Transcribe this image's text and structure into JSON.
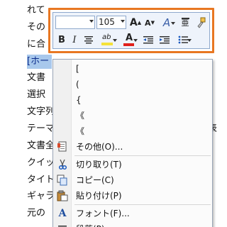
{
  "document": {
    "lines": [
      {
        "text": "れて"
      },
      {
        "text": "その"
      },
      {
        "text": "に合"
      },
      {
        "text": "[ホー",
        "selected": true
      },
      {
        "text": "文書"
      },
      {
        "text": "選択"
      },
      {
        "text": "文字列"
      },
      {
        "text": "テーマ"
      },
      {
        "text": "文書全"
      },
      {
        "text": "クイッ"
      },
      {
        "text": "タイト"
      },
      {
        "text": "ギャラ"
      },
      {
        "text": "元の"
      }
    ],
    "right_fragments": [
      {
        "text": "]"
      },
      {
        "text": "]"
      },
      {
        "text": "る表"
      }
    ]
  },
  "mini_toolbar": {
    "font_name": "",
    "font_size": "105",
    "grow_font": "A",
    "shrink_font": "A",
    "styles_label": "A",
    "phonetic_label": "亜",
    "bold": "B",
    "italic": "I",
    "highlight_label": "ab",
    "font_color_label": "A",
    "colors": {
      "highlight": "#f5e23a",
      "font_color": "#e0201b",
      "frame": "#e87722"
    }
  },
  "context_menu": {
    "items": [
      {
        "label": "[",
        "icon": ""
      },
      {
        "label": "(",
        "icon": ""
      },
      {
        "label": "{",
        "icon": ""
      },
      {
        "label": "《",
        "icon": ""
      },
      {
        "label": "《",
        "icon": ""
      },
      {
        "label": "その他(O)...",
        "icon": "document-icon"
      },
      {
        "label": "切り取り(T)",
        "icon": "scissors-icon"
      },
      {
        "label": "コピー(C)",
        "icon": "copy-icon"
      },
      {
        "label": "貼り付け(P)",
        "icon": "paste-icon"
      },
      {
        "label": "フォント(F)...",
        "icon": "font-icon"
      },
      {
        "label": "段落(P)...",
        "icon": "paragraph-icon"
      }
    ]
  }
}
